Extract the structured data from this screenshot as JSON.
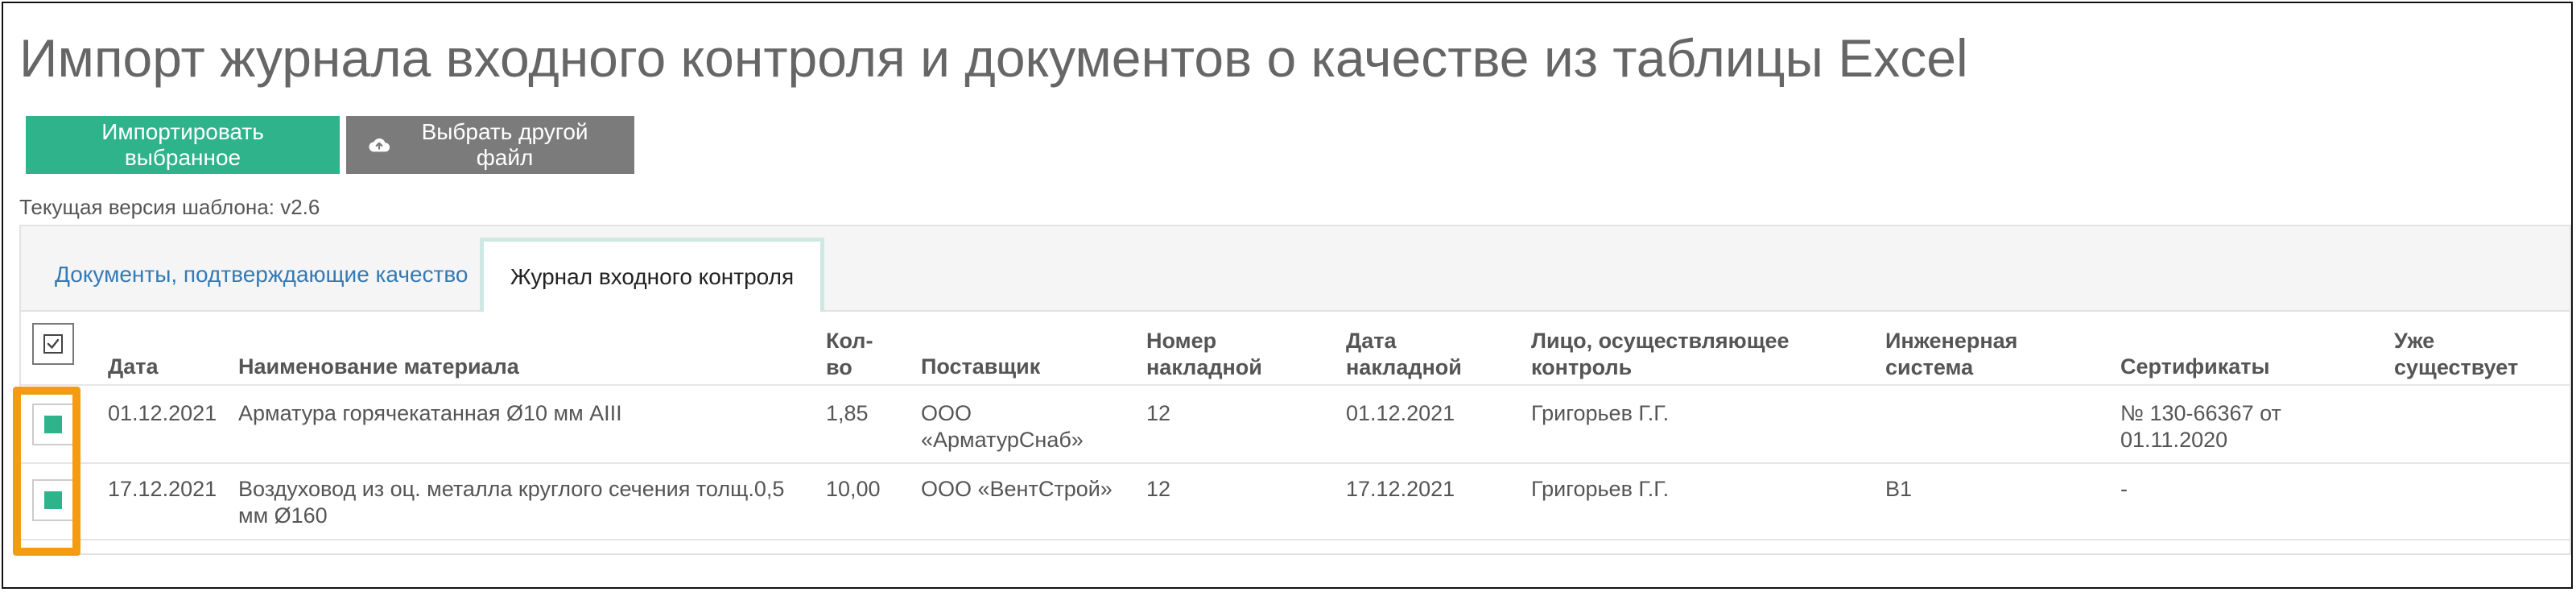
{
  "page": {
    "title": "Импорт журнала входного контроля и документов о качестве из таблицы Excel",
    "template_version": "Текущая версия шаблона: v2.6"
  },
  "toolbar": {
    "import_label": "Импортировать выбранное",
    "choose_file_label": "Выбрать другой файл",
    "choose_file_icon": "cloud-upload-icon"
  },
  "tabs": [
    {
      "label": "Документы, подтверждающие качество",
      "active": false
    },
    {
      "label": "Журнал входного контроля",
      "active": true
    }
  ],
  "table": {
    "header_checkbox_icon": "checkbox-check-icon",
    "columns": {
      "date": "Дата",
      "material": "Наименование материала",
      "qty_1": "Кол-",
      "qty_2": "во",
      "supplier": "Поставщик",
      "invoice_no_1": "Номер",
      "invoice_no_2": "накладной",
      "invoice_date_1": "Дата",
      "invoice_date_2": "накладной",
      "inspector_1": "Лицо, осуществляющее",
      "inspector_2": "контроль",
      "system_1": "Инженерная",
      "system_2": "система",
      "certificates": "Сертификаты",
      "exists_1": "Уже",
      "exists_2": "существует"
    },
    "rows": [
      {
        "checked": true,
        "date": "01.12.2021",
        "material_1": "Арматура горячекатанная Ø10 мм AIII",
        "material_2": "",
        "qty": "1,85",
        "supplier_1": "ООО",
        "supplier_2": "«АрматурСнаб»",
        "invoice_no": "12",
        "invoice_date": "01.12.2021",
        "inspector": "Григорьев Г.Г.",
        "system": "",
        "certificates_1": "№ 130-66367 от",
        "certificates_2": "01.11.2020",
        "exists": ""
      },
      {
        "checked": true,
        "date": "17.12.2021",
        "material_1": "Воздуховод из оц. металла круглого сечения толщ.0,5",
        "material_2": "мм Ø160",
        "qty": "10,00",
        "supplier_1": "ООО «ВентСтрой»",
        "supplier_2": "",
        "invoice_no": "12",
        "invoice_date": "17.12.2021",
        "inspector": "Григорьев Г.Г.",
        "system": "В1",
        "certificates_1": "-",
        "certificates_2": "",
        "exists": ""
      }
    ]
  },
  "colors": {
    "primary_button": "#2eb38a",
    "secondary_button": "#7b7b7b",
    "highlight": "#f39c12",
    "link": "#337ab7"
  }
}
